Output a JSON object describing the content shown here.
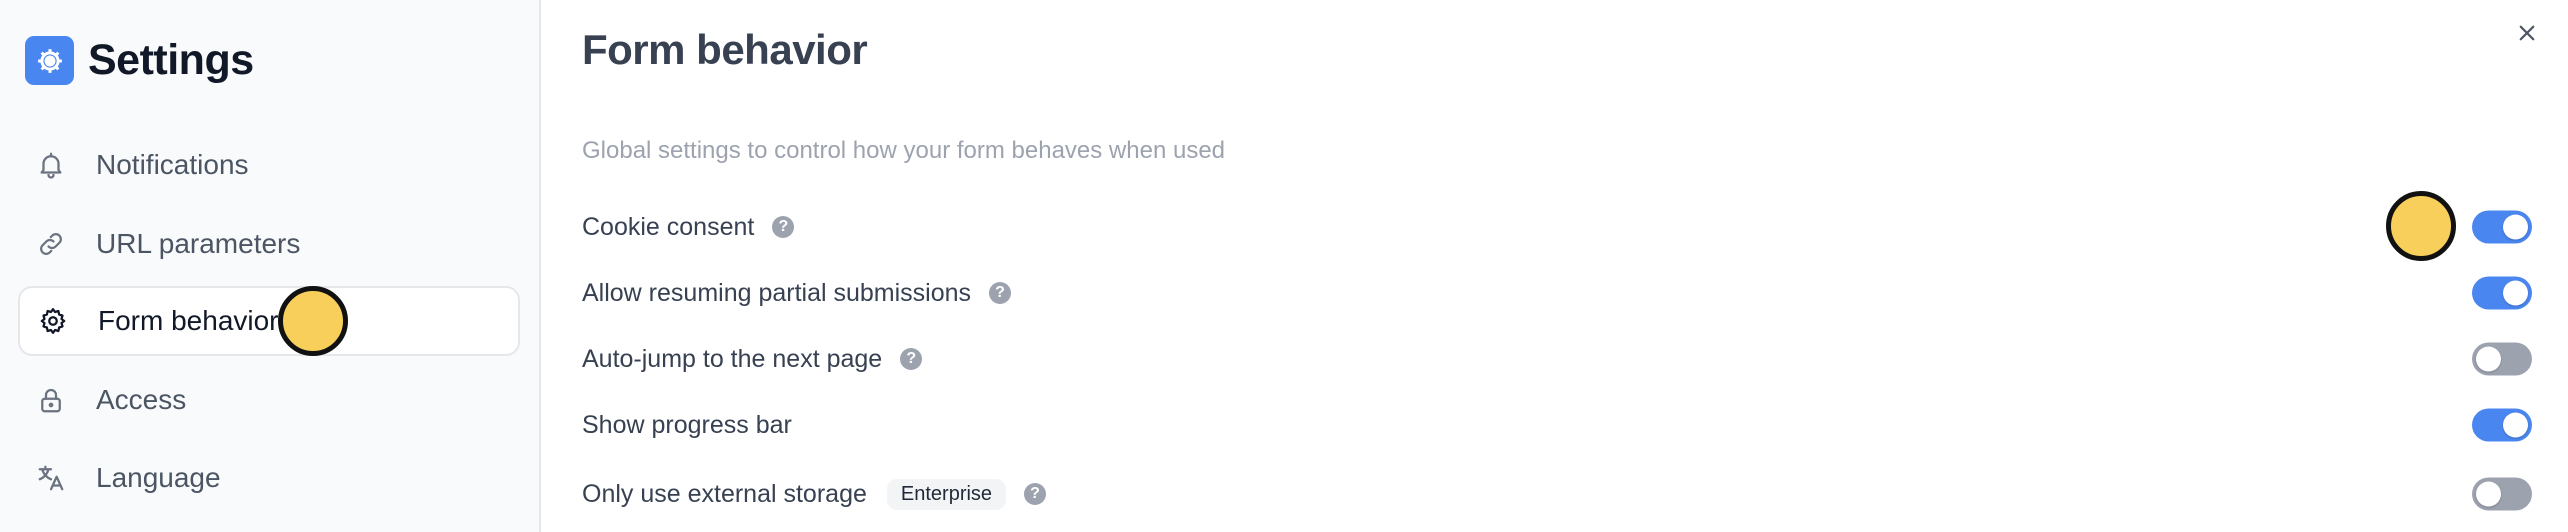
{
  "sidebar": {
    "title": "Settings",
    "items": [
      {
        "label": "Notifications",
        "icon": "bell-icon",
        "active": false
      },
      {
        "label": "URL parameters",
        "icon": "link-icon",
        "active": false
      },
      {
        "label": "Form behavior",
        "icon": "gear-icon",
        "active": true
      },
      {
        "label": "Access",
        "icon": "lock-icon",
        "active": false
      },
      {
        "label": "Language",
        "icon": "translate-icon",
        "active": false
      }
    ]
  },
  "main": {
    "title": "Form behavior",
    "description": "Global settings to control how your form behaves when used",
    "settings": [
      {
        "label": "Cookie consent",
        "help": "?",
        "enabled": true
      },
      {
        "label": "Allow resuming partial submissions",
        "help": "?",
        "enabled": true
      },
      {
        "label": "Auto-jump to the next page",
        "help": "?",
        "enabled": false
      },
      {
        "label": "Show progress bar",
        "enabled": true
      },
      {
        "label": "Only use external storage",
        "badge": "Enterprise",
        "help": "?",
        "enabled": false
      }
    ]
  },
  "colors": {
    "accent": "#4a86f0",
    "toggle_off": "#9ca3af",
    "marker": "#f8cf5a"
  }
}
